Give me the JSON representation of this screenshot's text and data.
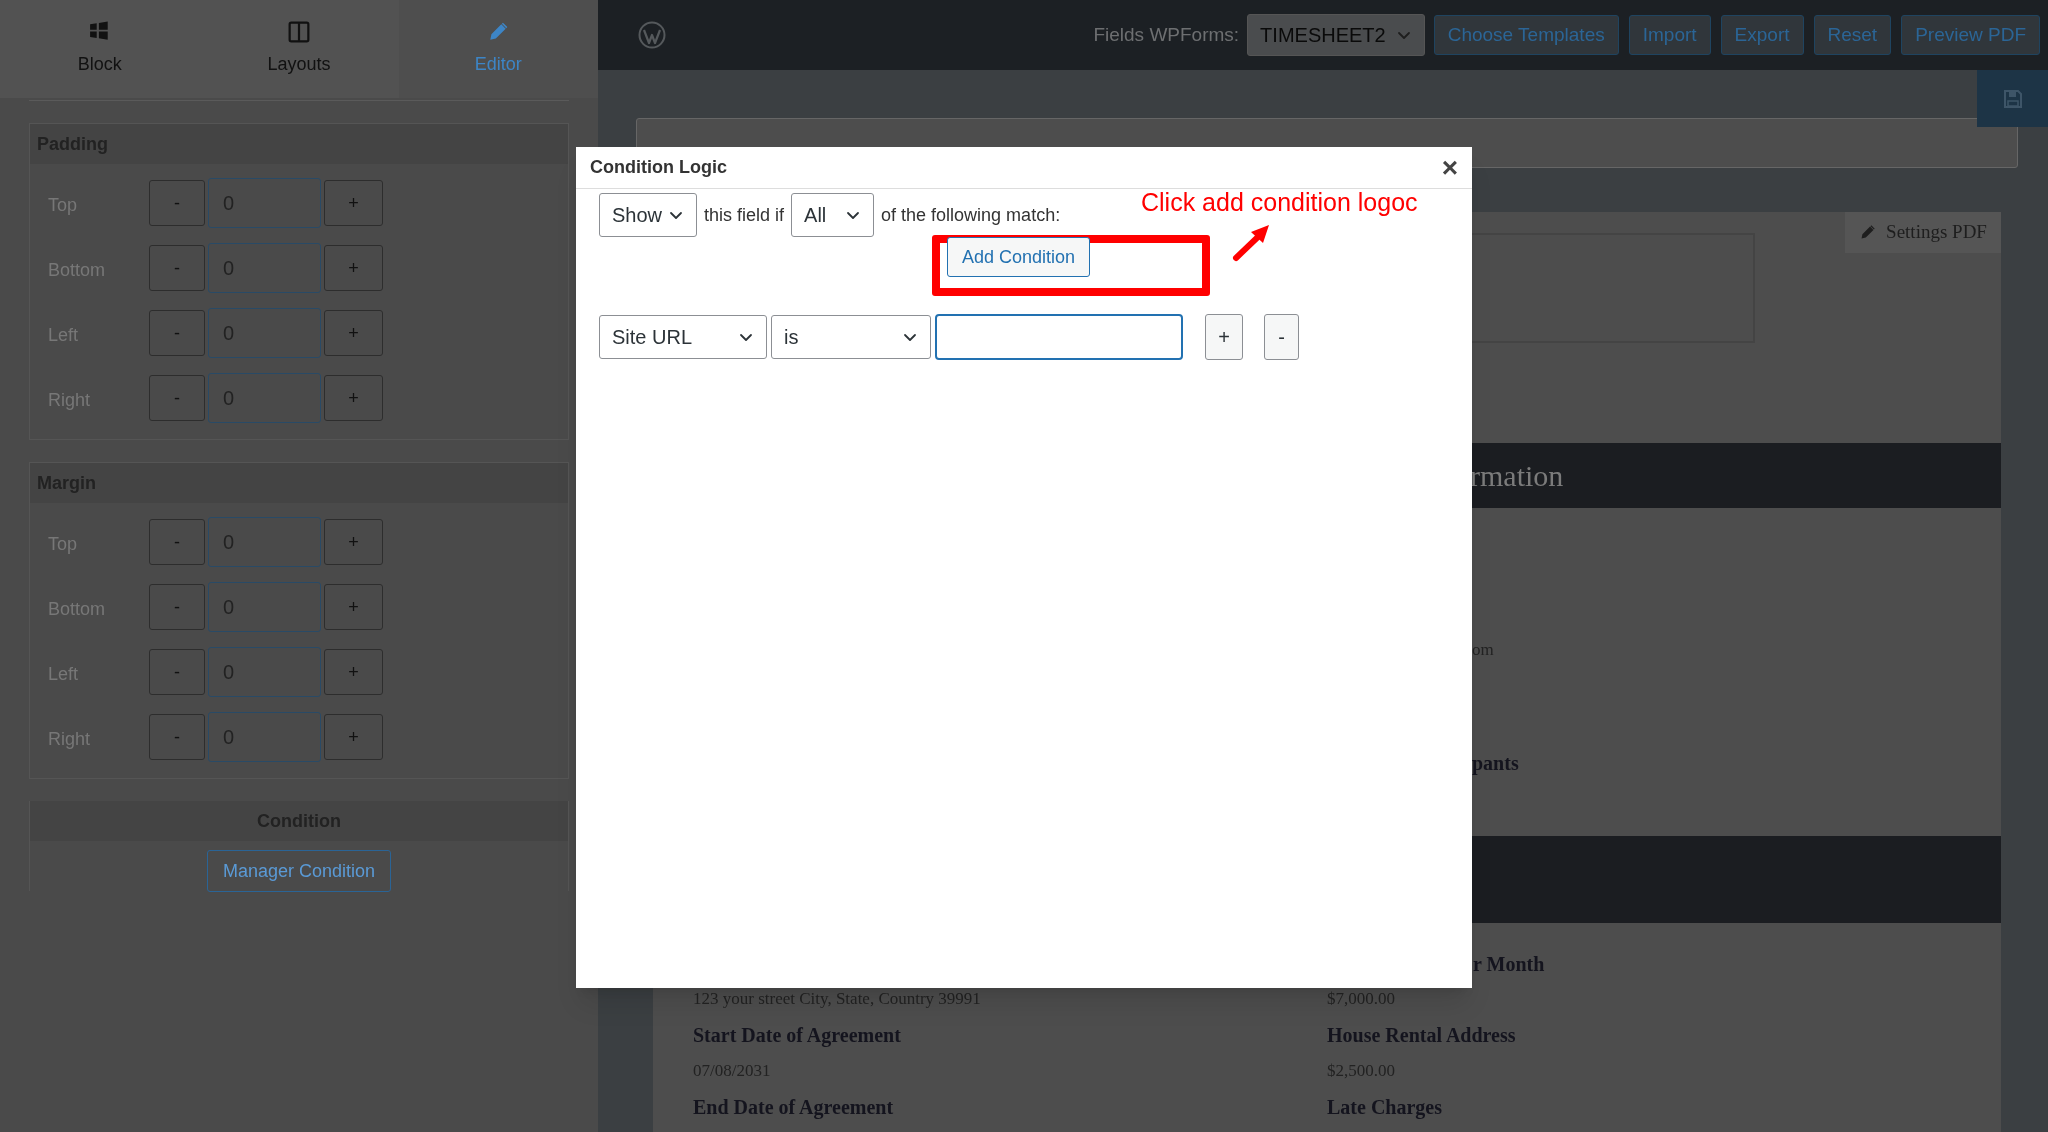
{
  "sidebar": {
    "tabs": [
      {
        "label": "Block",
        "selected": false
      },
      {
        "label": "Layouts",
        "selected": false
      },
      {
        "label": "Editor",
        "selected": true
      }
    ],
    "sections": [
      {
        "title": "Padding",
        "rows": [
          {
            "label": "Top",
            "minus": "-",
            "value": "0",
            "plus": "+"
          },
          {
            "label": "Bottom",
            "minus": "-",
            "value": "0",
            "plus": "+"
          },
          {
            "label": "Left",
            "minus": "-",
            "value": "0",
            "plus": "+"
          },
          {
            "label": "Right",
            "minus": "-",
            "value": "0",
            "plus": "+"
          }
        ]
      },
      {
        "title": "Margin",
        "rows": [
          {
            "label": "Top",
            "minus": "-",
            "value": "0",
            "plus": "+"
          },
          {
            "label": "Bottom",
            "minus": "-",
            "value": "0",
            "plus": "+"
          },
          {
            "label": "Left",
            "minus": "-",
            "value": "0",
            "plus": "+"
          },
          {
            "label": "Right",
            "minus": "-",
            "value": "0",
            "plus": "+"
          }
        ]
      }
    ],
    "condition": {
      "title": "Condition",
      "button": "Manager Condition"
    }
  },
  "toolbar": {
    "label": "Fields WPForms:",
    "form_select": "TIMESHEET2",
    "buttons": [
      "Choose Templates",
      "Import",
      "Export",
      "Reset",
      "Preview PDF"
    ]
  },
  "document": {
    "settings_button": "Settings PDF",
    "band_text": "rmation",
    "fragments": [
      {
        "kind": "value",
        "text": "om"
      },
      {
        "kind": "label",
        "text": "pants"
      }
    ],
    "right_fragment": "r Month",
    "left_column": [
      {
        "kind": "value",
        "text": "123 your street City, State, Country 39991"
      },
      {
        "kind": "label",
        "text": "Start Date of Agreement"
      },
      {
        "kind": "value",
        "text": "07/08/2031"
      },
      {
        "kind": "label",
        "text": "End Date of Agreement"
      }
    ],
    "right_column": [
      {
        "kind": "value",
        "text": "$7,000.00"
      },
      {
        "kind": "label",
        "text": "House Rental Address"
      },
      {
        "kind": "value",
        "text": "$2,500.00"
      },
      {
        "kind": "label",
        "text": "Late Charges"
      }
    ]
  },
  "modal": {
    "title": "Condition Logic",
    "close": "×",
    "action_select": "Show",
    "text_1": "this field if",
    "match_select": "All",
    "text_2": "of the following match:",
    "add_button": "Add Condition",
    "annotation": "Click add condition logoc",
    "rule": {
      "field": "Site URL",
      "operator": "is",
      "add": "+",
      "remove": "-"
    }
  }
}
